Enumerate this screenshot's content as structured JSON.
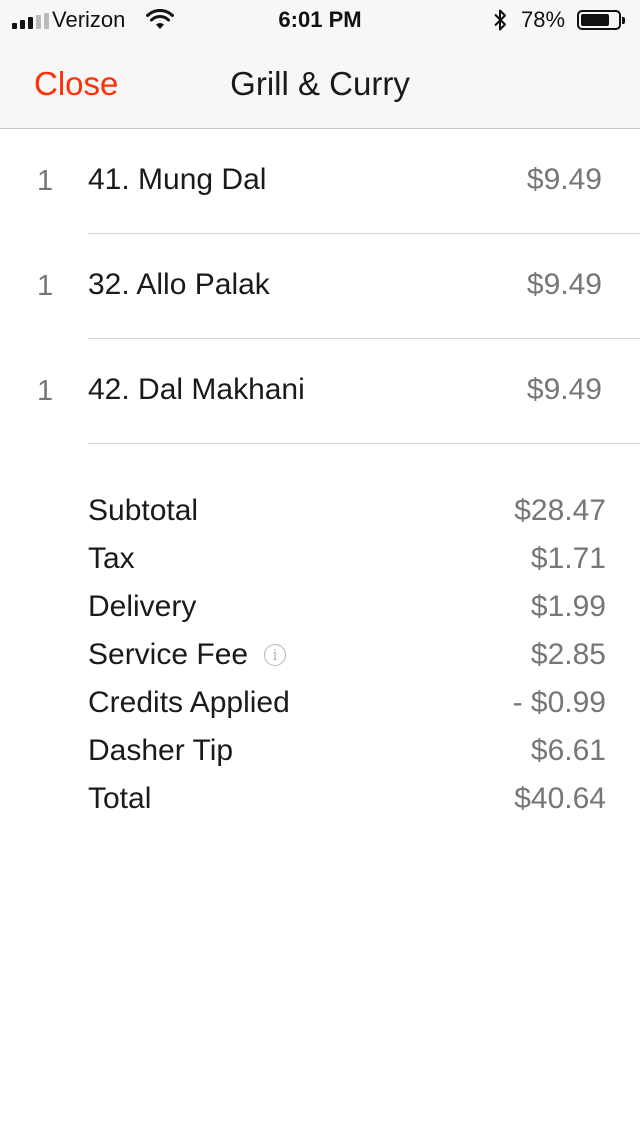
{
  "status_bar": {
    "carrier": "Verizon",
    "time": "6:01 PM",
    "battery_percent_text": "78%",
    "battery_level": 0.78,
    "signal_bars_filled": 3,
    "signal_bars_total": 5
  },
  "nav": {
    "close_label": "Close",
    "title": "Grill & Curry"
  },
  "items": [
    {
      "qty": "1",
      "name": "41. Mung Dal",
      "price": "$9.49"
    },
    {
      "qty": "1",
      "name": "32. Allo Palak",
      "price": "$9.49"
    },
    {
      "qty": "1",
      "name": "42. Dal Makhani",
      "price": "$9.49"
    }
  ],
  "summary": [
    {
      "label": "Subtotal",
      "value": "$28.47"
    },
    {
      "label": "Tax",
      "value": "$1.71"
    },
    {
      "label": "Delivery",
      "value": "$1.99"
    },
    {
      "label": "Service Fee",
      "value": "$2.85"
    },
    {
      "label": "Credits Applied",
      "value": "- $0.99"
    },
    {
      "label": "Dasher Tip",
      "value": "$6.61"
    },
    {
      "label": "Total",
      "value": "$40.64"
    }
  ],
  "colors": {
    "accent": "#ff3008",
    "secondary_text": "#767676",
    "primary_text": "#1a1a1a",
    "bar_background": "#f7f7f7"
  }
}
